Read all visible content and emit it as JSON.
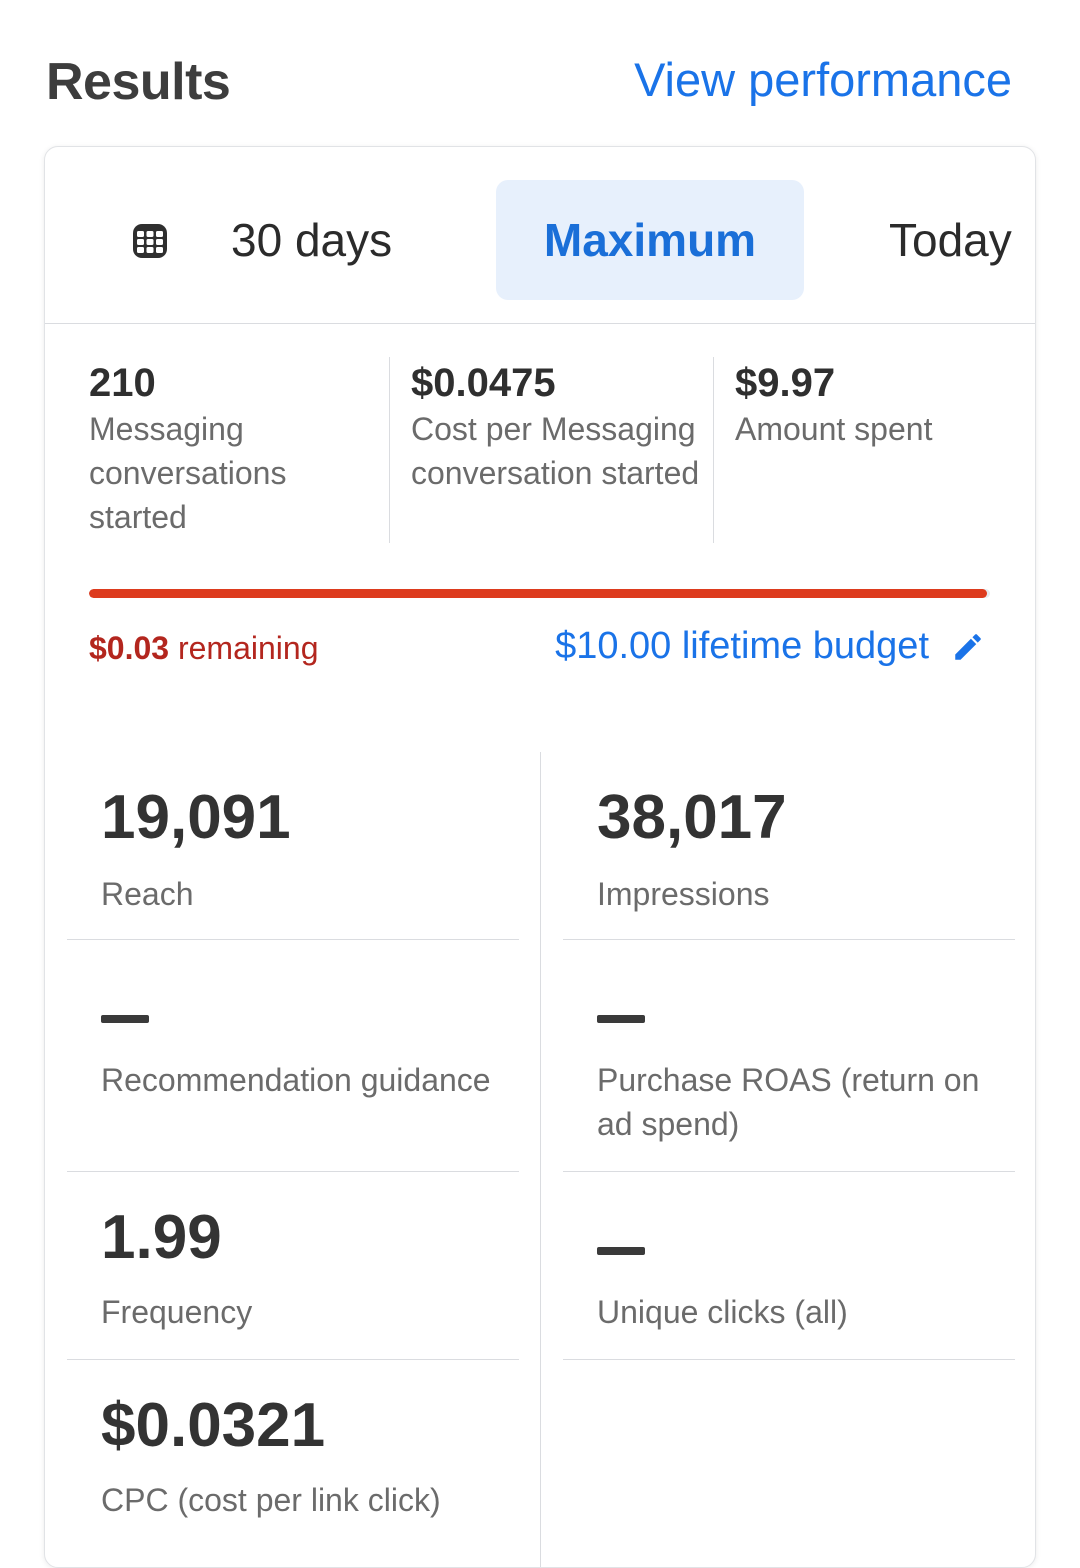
{
  "header": {
    "title": "Results",
    "view_performance": "View performance"
  },
  "tabs": {
    "items": [
      "30 days",
      "Maximum",
      "Today"
    ],
    "selected": "Maximum"
  },
  "summary": [
    {
      "value": "210",
      "label": "Messaging conversations started"
    },
    {
      "value": "$0.0475",
      "label": "Cost per Messaging conversation started"
    },
    {
      "value": "$9.97",
      "label": "Amount spent"
    }
  ],
  "budget": {
    "remaining_amount": "$0.03",
    "remaining_word": "remaining",
    "lifetime_budget": "$10.00 lifetime budget",
    "spent_fraction": 0.997
  },
  "metrics": {
    "reach": {
      "value": "19,091",
      "label": "Reach"
    },
    "impressions": {
      "value": "38,017",
      "label": "Impressions"
    },
    "recommendation": {
      "value": "--",
      "label": "Recommendation guidance"
    },
    "roas": {
      "value": "--",
      "label": "Purchase ROAS (return on ad spend)"
    },
    "frequency": {
      "value": "1.99",
      "label": "Frequency"
    },
    "unique_clicks": {
      "value": "--",
      "label": "Unique clicks (all)"
    },
    "cpc": {
      "value": "$0.0321",
      "label": "CPC (cost per link click)"
    }
  },
  "colors": {
    "accent": "#1a73e8",
    "selected_tab_bg": "#e7f0fc",
    "budget_bar": "#dd3b1e",
    "remaining_text": "#b3261e"
  },
  "icons": {
    "calendar": "calendar-icon",
    "edit": "pencil-icon"
  }
}
